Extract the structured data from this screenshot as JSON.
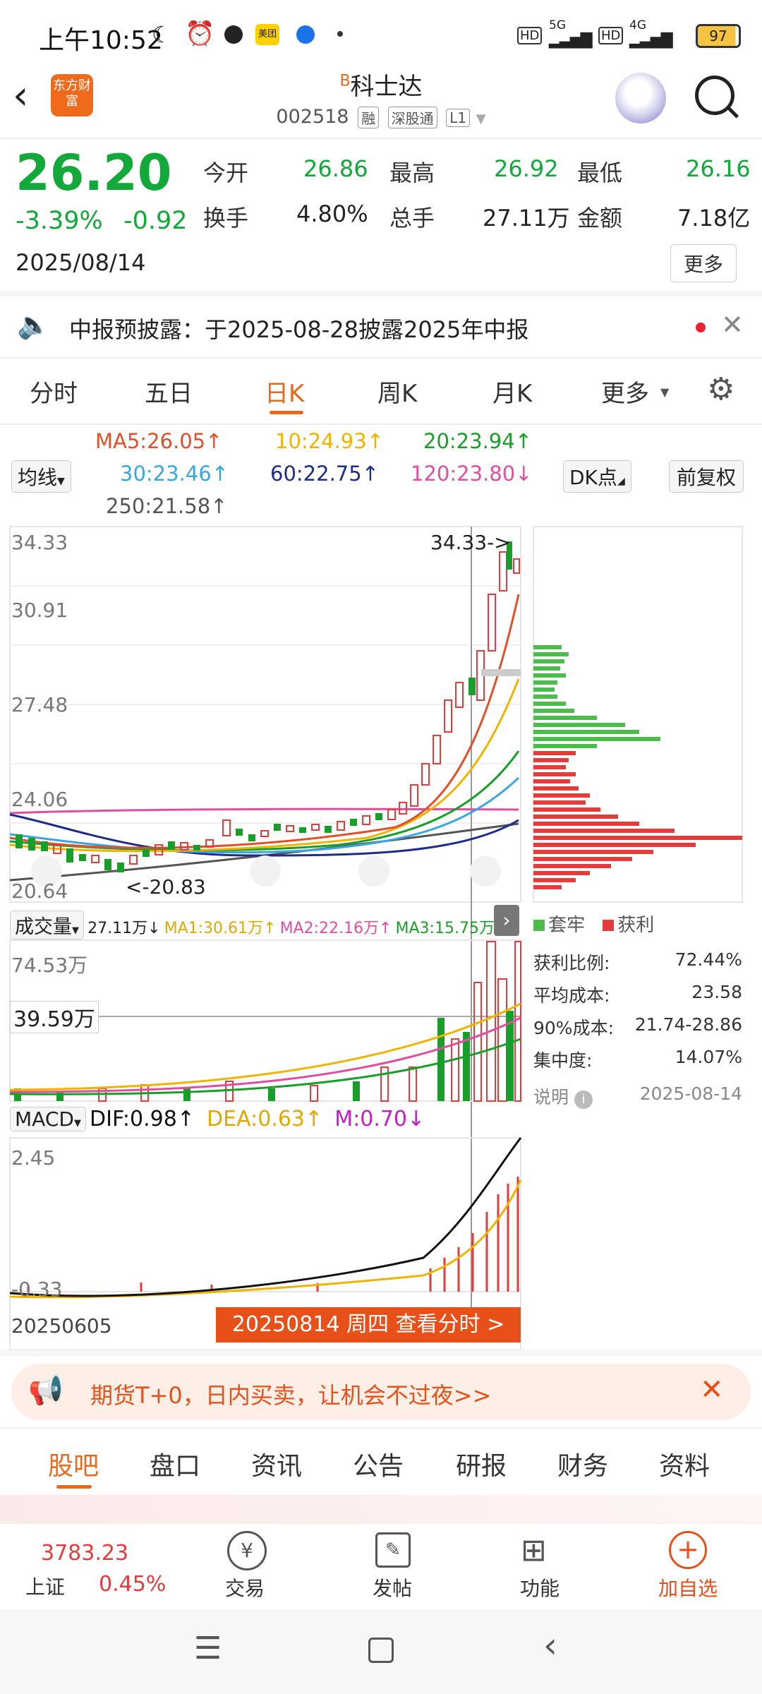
{
  "status": {
    "time": "上午10:52",
    "battery": "97",
    "signal1": "5G",
    "signal2": "4G",
    "app_badge": "美团"
  },
  "header": {
    "title": "科士达",
    "title_prefix": "B",
    "code": "002518",
    "tags": [
      "融",
      "深股通",
      "L1"
    ],
    "logo_text": "东方财富"
  },
  "quote": {
    "price": "26.20",
    "change_pct": "-3.39%",
    "change_amt": "-0.92",
    "date": "2025/08/14",
    "fields": [
      {
        "label": "今开",
        "value": "26.86",
        "color": "green"
      },
      {
        "label": "最高",
        "value": "26.92",
        "color": "green"
      },
      {
        "label": "最低",
        "value": "26.16",
        "color": "green"
      },
      {
        "label": "换手",
        "value": "4.80%",
        "color": "dark"
      },
      {
        "label": "总手",
        "value": "27.11万",
        "color": "dark"
      },
      {
        "label": "金额",
        "value": "7.18亿",
        "color": "dark"
      }
    ],
    "more_label": "更多"
  },
  "notice": {
    "text": "中报预披露：于2025-08-28披露2025年中报"
  },
  "tabs": {
    "items": [
      "分时",
      "五日",
      "日K",
      "周K",
      "月K",
      "更多"
    ],
    "active": 2
  },
  "ma": {
    "selector": "均线",
    "items": [
      {
        "text": "MA5:26.05↑",
        "color": "#e0502b"
      },
      {
        "text": "10:24.93↑",
        "color": "#f0b400"
      },
      {
        "text": "20:23.94↑",
        "color": "#1a9e2a"
      },
      {
        "text": "30:23.46↑",
        "color": "#3aa6e0"
      },
      {
        "text": "60:22.75↑",
        "color": "#1d2c8a"
      },
      {
        "text": "120:23.80↓",
        "color": "#e04ea0"
      },
      {
        "text": "250:21.58↑",
        "color": "#555555"
      }
    ],
    "dk_label": "DK点",
    "adjust_label": "前复权"
  },
  "kline": {
    "y_labels": [
      "34.33",
      "30.91",
      "27.48",
      "24.06",
      "20.64"
    ],
    "high_marker": "34.33->",
    "low_marker": "<-20.83"
  },
  "chip": {
    "legend_trap": "套牢",
    "legend_profit": "获利",
    "stats": [
      {
        "label": "获利比例:",
        "value": "72.44%"
      },
      {
        "label": "平均成本:",
        "value": "23.58"
      },
      {
        "label": "90%成本:",
        "value": "21.74-28.86"
      },
      {
        "label": "集中度:",
        "value": "14.07%"
      }
    ],
    "note_label": "说明",
    "note_date": "2025-08-14"
  },
  "volume": {
    "selector": "成交量",
    "summary": "27.11万↓",
    "ma1": "MA1:30.61万↑",
    "ma2": "MA2:22.16万↑",
    "ma3": "MA3:15.75万↑",
    "top_label": "74.53万",
    "cursor_label": "39.59万"
  },
  "macd": {
    "selector": "MACD",
    "dif": "DIF:0.98↑",
    "dea": "DEA:0.63↑",
    "m": "M:0.70↓",
    "top_label": "2.45",
    "bottom_label": "-0.33"
  },
  "timeline": {
    "start": "20250605",
    "cursor": "20250814 周四 查看分时 >"
  },
  "ad": {
    "text": "期货T+0，日内买卖，让机会不过夜>>"
  },
  "bottom_tabs": {
    "items": [
      "股吧",
      "盘口",
      "资讯",
      "公告",
      "研报",
      "财务",
      "资料"
    ],
    "active": 0
  },
  "nav": {
    "index_value": "3783.23",
    "index_name": "上证",
    "index_change": "0.45%",
    "items": [
      "交易",
      "发帖",
      "功能",
      "加自选"
    ]
  }
}
